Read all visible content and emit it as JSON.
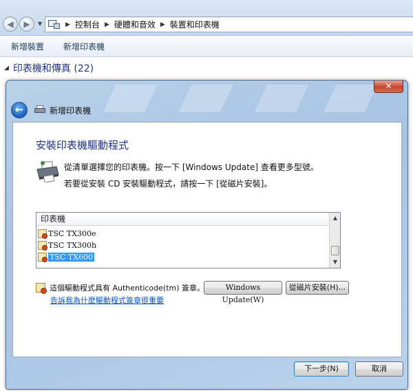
{
  "explorer": {
    "breadcrumbs": [
      "控制台",
      "硬體和音效",
      "裝置和印表機"
    ],
    "commands": [
      "新增裝置",
      "新增印表機"
    ],
    "group_header": "印表機和傳真 (22)",
    "icons": {
      "back": "back-arrow-icon",
      "forward": "forward-arrow-icon",
      "location": "devices-printers-icon"
    }
  },
  "dialog": {
    "title": "新增印表機",
    "close_label": "✕",
    "heading": "安裝印表機驅動程式",
    "instruction_1": "從清單選擇您的印表機。按一下 [Windows Update] 查看更多型號。",
    "instruction_2": "若要從安裝 CD 安裝驅動程式，請按一下 [從磁片安裝]。",
    "list": {
      "header": "印表機",
      "items": [
        {
          "label": "TSC TX300e",
          "selected": false
        },
        {
          "label": "TSC TX300h",
          "selected": false
        },
        {
          "label": "TSC TX600",
          "selected": true
        }
      ]
    },
    "signature_text": "這個驅動程式具有 Authenticode(tm) 簽章。",
    "windows_update_button": "Windows Update(W)",
    "have_disk_button": "從磁片安裝(H)...",
    "why_link": "告訴我為什麼驅動程式簽章很重要",
    "next_button": "下一步(N)",
    "cancel_button": "取消"
  }
}
